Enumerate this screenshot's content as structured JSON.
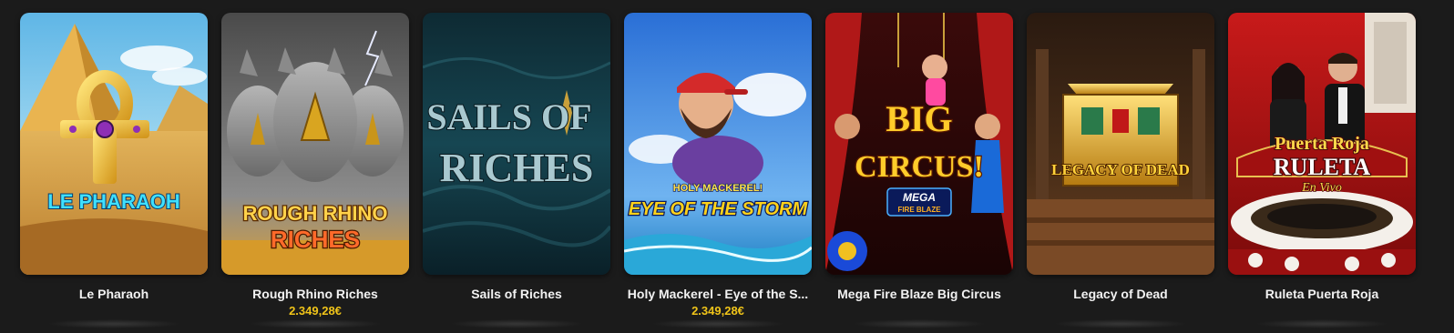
{
  "games": [
    {
      "name": "Le Pharaoh",
      "logo_lines": [
        "LE PHARAOH"
      ],
      "jackpot": null,
      "icon": "ankh-logo-art"
    },
    {
      "name": "Rough Rhino Riches",
      "logo_lines": [
        "ROUGH RHINO",
        "RICHES"
      ],
      "jackpot": "2.349,28€",
      "icon": "rhino-herd-art"
    },
    {
      "name": "Sails of Riches",
      "logo_lines": [
        "SAILS OF",
        "RICHES"
      ],
      "jackpot": null,
      "icon": "stormy-sea-art"
    },
    {
      "name": "Holy Mackerel - Eye of the Storm",
      "display_name": "Holy Mackerel - Eye of the S...",
      "logo_lines": [
        "HOLY MACKEREL!",
        "EYE OF THE STORM"
      ],
      "jackpot": "2.349,28€",
      "icon": "fisherman-art"
    },
    {
      "name": "Mega Fire Blaze Big Circus",
      "logo_lines": [
        "BIG",
        "CIRCUS!",
        "MEGA",
        "FIRE BLAZE"
      ],
      "jackpot": null,
      "icon": "circus-tent-art"
    },
    {
      "name": "Legacy of Dead",
      "logo_lines": [
        "LEGACY OF DEAD"
      ],
      "jackpot": null,
      "icon": "golden-sarcophagus-art"
    },
    {
      "name": "Ruleta Puerta Roja",
      "logo_lines": [
        "Puerta Roja",
        "RULETA",
        "En Vivo"
      ],
      "jackpot": null,
      "icon": "roulette-hosts-art"
    }
  ],
  "colors": {
    "background": "#1b1b1b",
    "title_text": "#f2f2f2",
    "jackpot_text": "#f0c419"
  }
}
